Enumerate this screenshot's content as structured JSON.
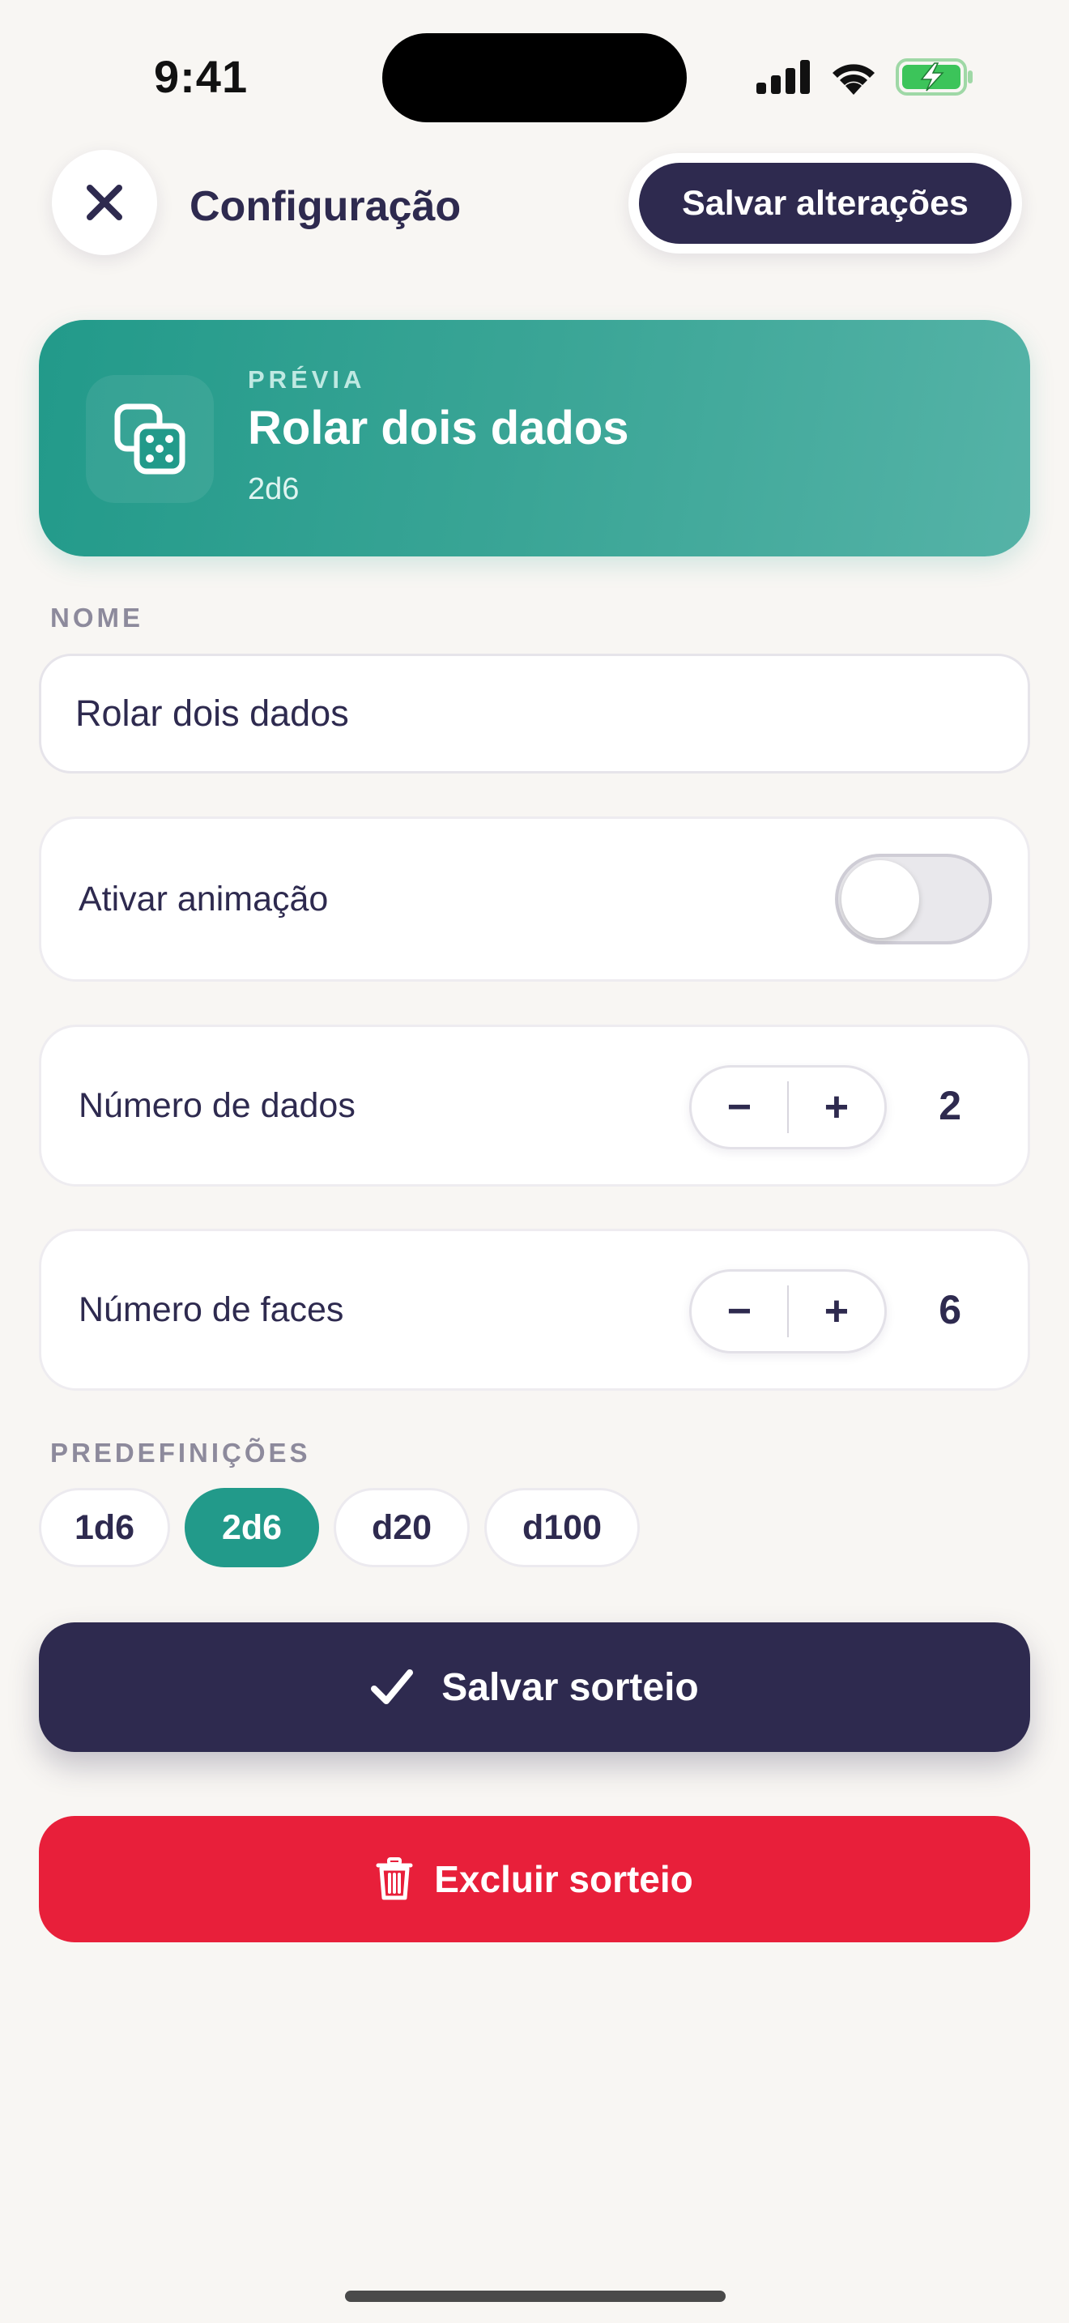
{
  "status_bar": {
    "time": "9:41"
  },
  "header": {
    "title": "Configuração",
    "save_changes_label": "Salvar alterações"
  },
  "preview": {
    "eyebrow": "PRÉVIA",
    "title": "Rolar dois dados",
    "subtitle": "2d6"
  },
  "name_section": {
    "label": "NOME",
    "value": "Rolar dois dados"
  },
  "animation_row": {
    "label": "Ativar animação",
    "enabled": false
  },
  "dice_count_row": {
    "label": "Número de dados",
    "value": "2",
    "minus": "−",
    "plus": "+"
  },
  "faces_row": {
    "label": "Número de faces",
    "value": "6",
    "minus": "−",
    "plus": "+"
  },
  "presets": {
    "label": "PREDEFINIÇÕES",
    "items": [
      {
        "label": "1d6",
        "active": false
      },
      {
        "label": "2d6",
        "active": true
      },
      {
        "label": "d20",
        "active": false
      },
      {
        "label": "d100",
        "active": false
      }
    ]
  },
  "actions": {
    "save_label": "Salvar sorteio",
    "delete_label": "Excluir sorteio"
  },
  "colors": {
    "accent": "#229a8a",
    "primary": "#2e2a4f",
    "danger": "#e81f3a",
    "background": "#f8f6f3"
  }
}
